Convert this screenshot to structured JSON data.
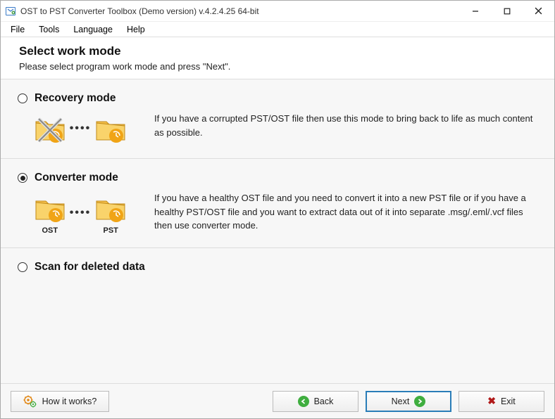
{
  "title": "OST to PST Converter Toolbox (Demo version) v.4.2.4.25 64-bit",
  "menu": {
    "file": "File",
    "tools": "Tools",
    "language": "Language",
    "help": "Help"
  },
  "header": {
    "title": "Select work mode",
    "subtitle": "Please select program work mode and press \"Next\"."
  },
  "modes": {
    "recovery": {
      "title": "Recovery mode",
      "desc": "If you have a corrupted PST/OST file then use this mode to bring back to life as much content as possible.",
      "selected": false
    },
    "converter": {
      "title": "Converter mode",
      "desc": "If you have a healthy OST file and you need to convert it into a new PST file or if you have a healthy PST/OST file and you want to extract data out of it into separate .msg/.eml/.vcf files then use converter mode.",
      "selected": true,
      "label_left": "OST",
      "label_right": "PST"
    },
    "scan": {
      "title": "Scan for deleted data",
      "selected": false
    }
  },
  "footer": {
    "how": "How it works?",
    "back": "Back",
    "next": "Next",
    "exit": "Exit"
  }
}
